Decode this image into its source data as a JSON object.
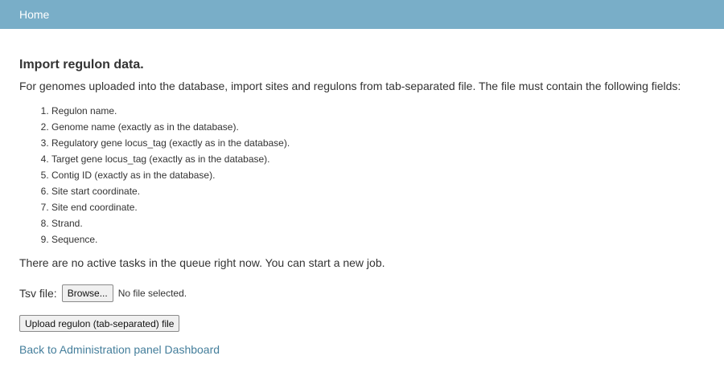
{
  "header": {
    "home_label": "Home"
  },
  "main": {
    "title": "Import regulon data.",
    "intro": "For genomes uploaded into the database, import sites and regulons from tab-separated file. The file must contain the following fields:",
    "fields": [
      "Regulon name.",
      "Genome name (exactly as in the database).",
      "Regulatory gene locus_tag (exactly as in the database).",
      "Target gene locus_tag (exactly as in the database).",
      "Contig ID (exactly as in the database).",
      "Site start coordinate.",
      "Site end coordinate.",
      "Strand.",
      "Sequence."
    ],
    "status": "There are no active tasks in the queue right now. You can start a new job."
  },
  "form": {
    "file_label": "Tsv file:",
    "browse_label": "Browse...",
    "no_file_text": "No file selected.",
    "upload_label": "Upload regulon (tab-separated) file"
  },
  "footer": {
    "back_link": "Back to Administration panel Dashboard"
  },
  "colors": {
    "header_bg": "#79aec8",
    "link": "#447e9b"
  }
}
